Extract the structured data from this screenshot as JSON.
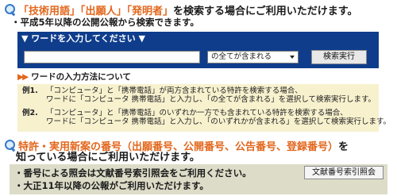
{
  "section1": {
    "q1": "「技術用語」",
    "q2": "「出願人」",
    "q3": "「発明者」",
    "title_rest": "を検索する場合にご利用いただけます。",
    "note": "・平成5年以降の公開公報から検索できます。"
  },
  "search": {
    "header": "▼ ワードを入力してください ▼",
    "input_value": "",
    "select_value": "の全てが含まれる",
    "button_label": "検索実行"
  },
  "help": {
    "arrows": "▶▶",
    "heading": "ワードの入力方法について",
    "ex1_label": "例1.",
    "ex1_line1": "「コンピュータ」と「携帯電話」が両方含まれている特許を検索する場合、",
    "ex1_line2": "ワードに「コンピュータ 携帯電話」と入力し、「の全てが含まれる」を選択して検索実行します。",
    "ex2_label": "例2.",
    "ex2_line1": "「コンピュータ」と「携帯電話」のいずれか一方でも含まれている特許を検索する場合、",
    "ex2_line2": "ワードに「コンピュータ 携帯電話」と入力し、「のいずれかが含まれる」を選択して検索実行します。"
  },
  "section2": {
    "title_highlight": "特許・実用新案の番号（出願番号、公開番号、公告番号、登録番号）",
    "title_rest": "を",
    "title_line2": "知っている場合にご利用いただけます。",
    "bullet1": "・番号による照会は文献番号索引照会をご利用ください。",
    "bullet2": "・大正11年以降の公報がご利用いただけます。",
    "button_label": "文献番号索引照会"
  }
}
